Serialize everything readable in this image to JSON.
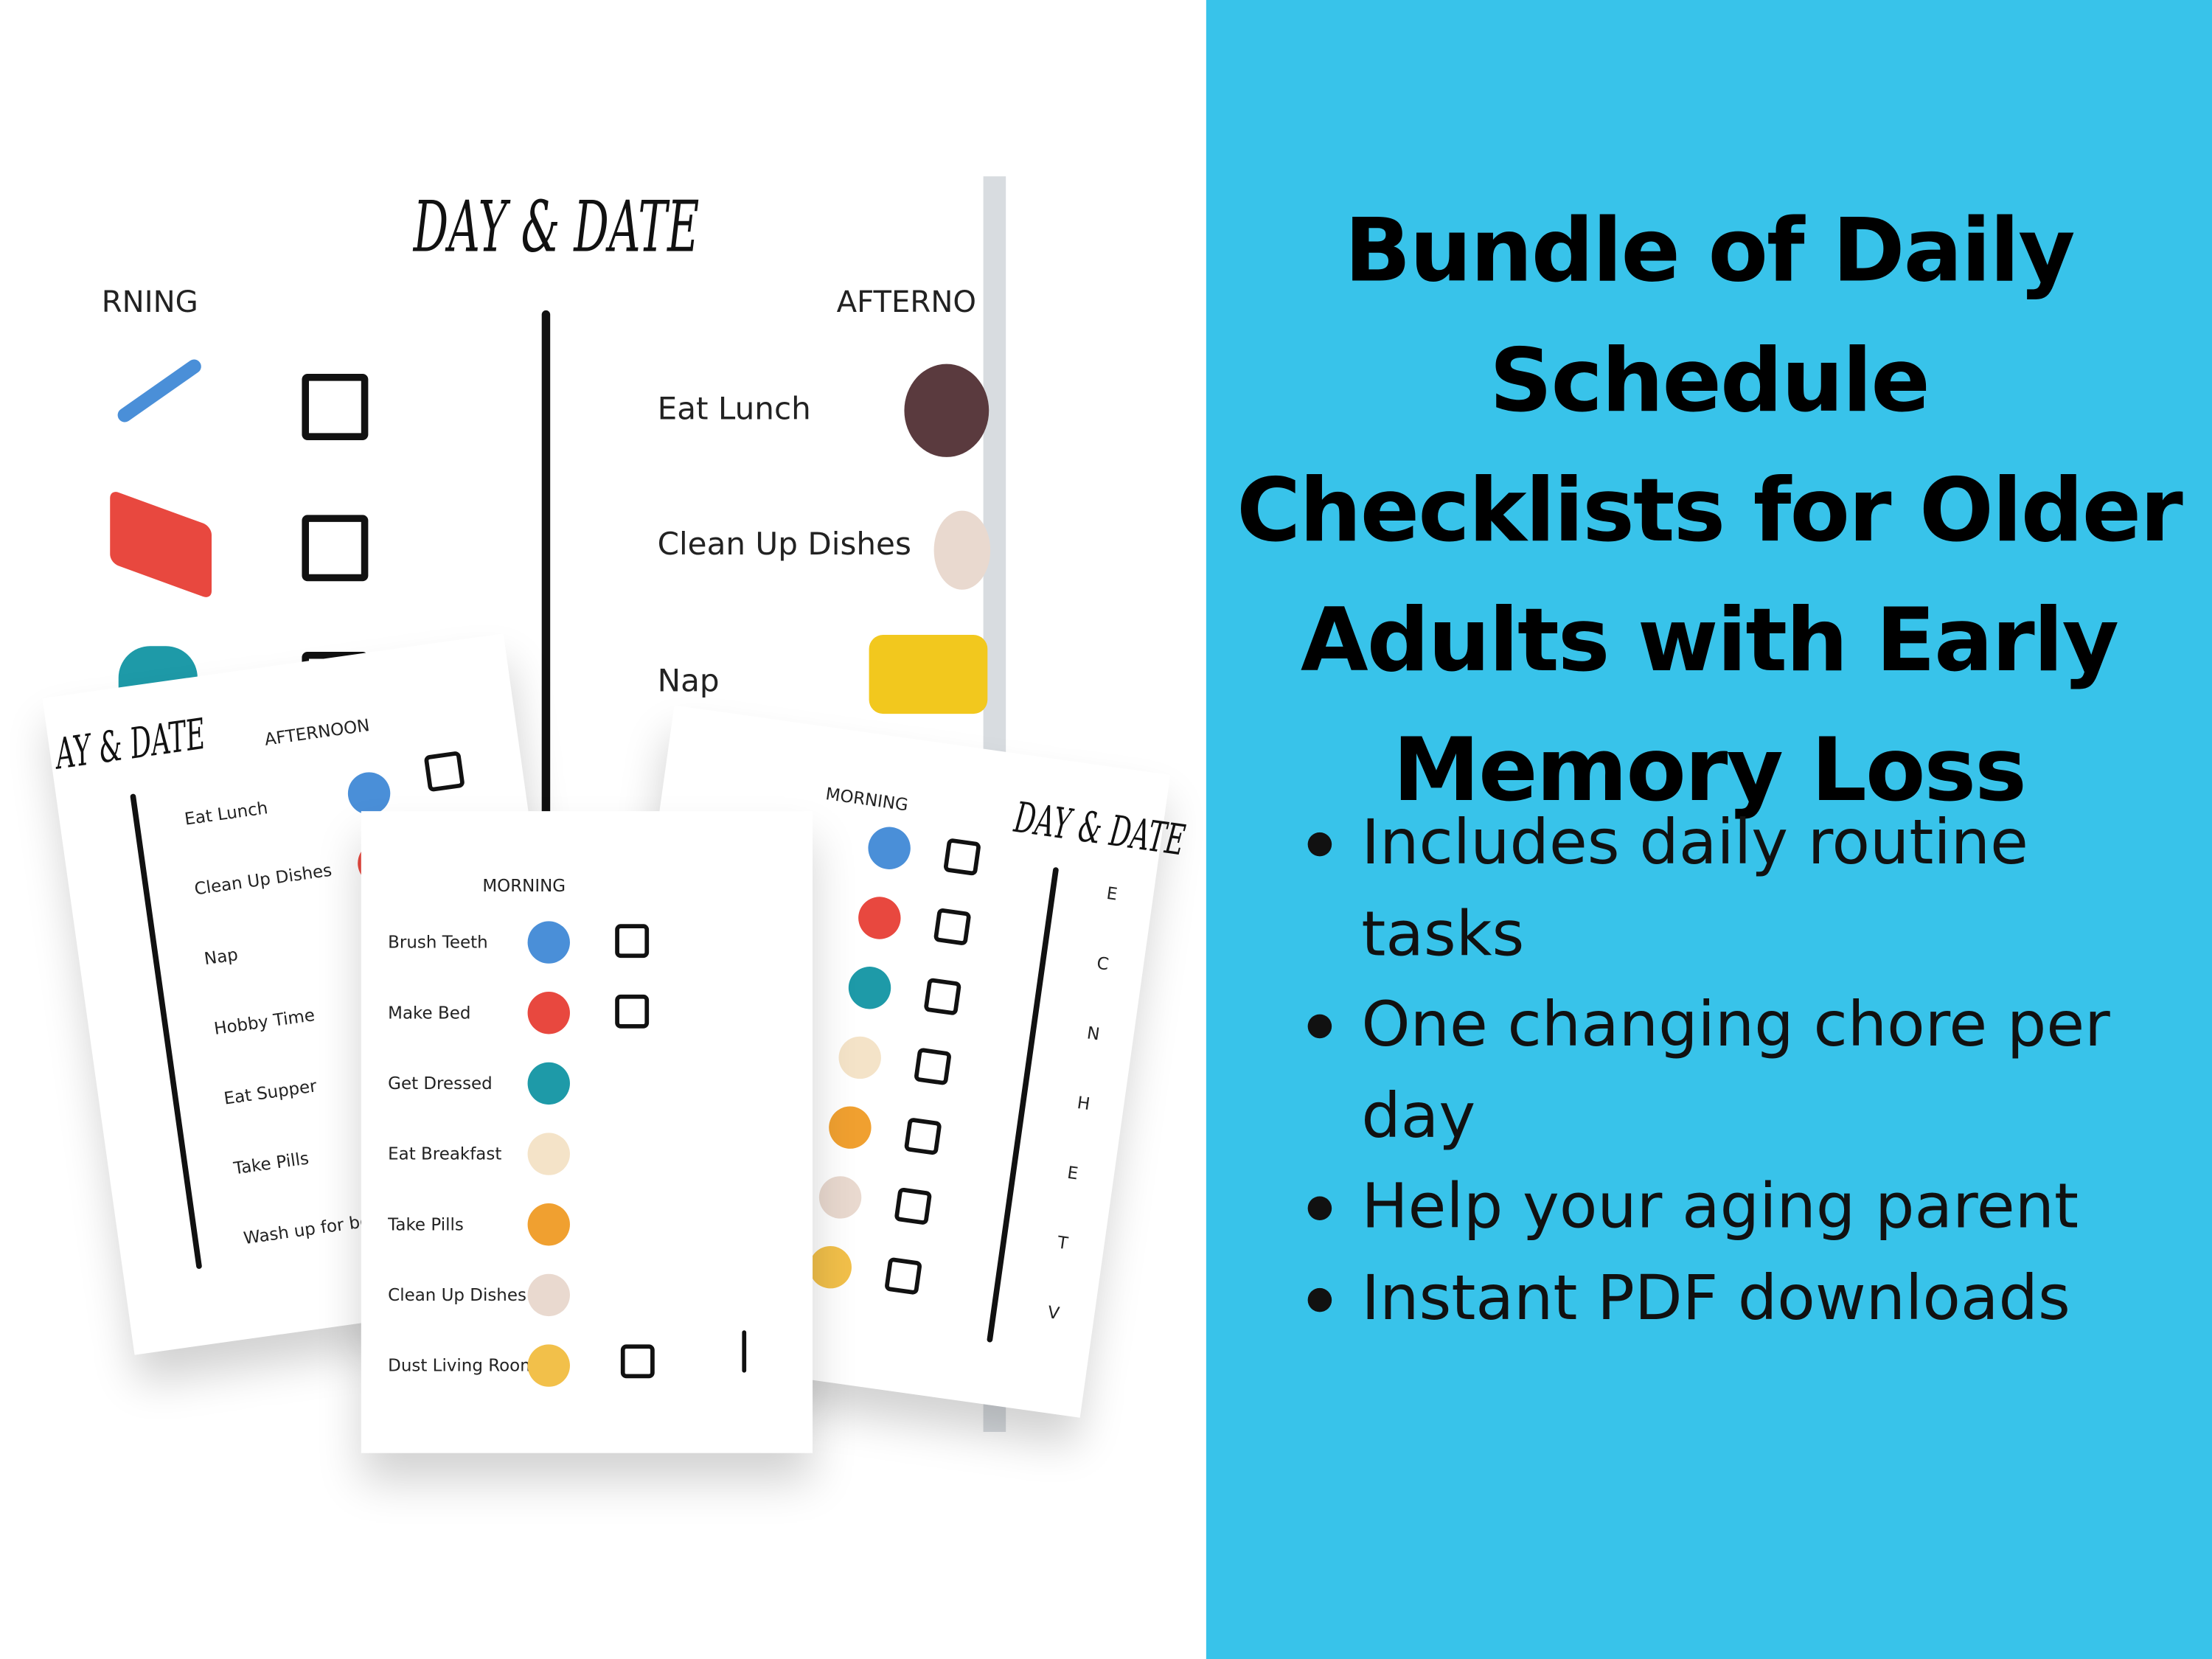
{
  "headline": "Bundle of Daily Schedule Checklists for Older Adults with Early Memory Loss",
  "bullets": [
    "Includes daily routine tasks",
    "One changing chore per day",
    "Help your aging parent",
    "Instant PDF downloads"
  ],
  "colors": {
    "panel": "#38c3ea",
    "text": "#111111"
  },
  "back_sheet": {
    "title": "DAY & DATE",
    "left_header": "RNING",
    "right_header": "AFTERNO",
    "afternoon_items": [
      "Eat Lunch",
      "Clean Up Dishes",
      "Nap"
    ],
    "morning_icons": [
      "toothbrush-icon",
      "bed-icon",
      "person-dressed-icon"
    ]
  },
  "left_sheet": {
    "title": "AY & DATE",
    "header": "AFTERNOON",
    "items": [
      "Eat Lunch",
      "Clean Up Dishes",
      "Nap",
      "Hobby Time",
      "Eat Supper",
      "Take Pills",
      "Wash up for be"
    ]
  },
  "right_sheet": {
    "title": "DAY & DATE",
    "header": "MORNING",
    "items": [
      "Brush Teeth",
      "Make Bed",
      "Get Dressed",
      "Eat Breakfast",
      "Take Pills",
      "Clean Up Dishes",
      "Dust Living Room"
    ],
    "side_letters": [
      "E",
      "C",
      "N",
      "H",
      "E",
      "T",
      "V"
    ]
  },
  "front_sheet": {
    "header": "MORNING",
    "items": [
      "Brush Teeth",
      "Make Bed",
      "Get Dressed",
      "Eat Breakfast",
      "Take Pills",
      "Clean Up Dishes",
      "Dust Living Room"
    ]
  }
}
